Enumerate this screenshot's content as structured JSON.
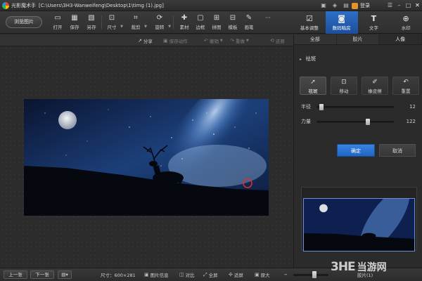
{
  "app": {
    "name": "光影魔术手",
    "path": "[C:\\Users\\3H3-Wanweifeng\\Desktop\\1\\timg (1).jpg]",
    "login_label": "登录"
  },
  "toolbar": {
    "browse_label": "浏览图片",
    "tools": [
      {
        "label": "打开",
        "icon": "folder-open-icon"
      },
      {
        "label": "保存",
        "icon": "save-icon"
      },
      {
        "label": "另存",
        "icon": "save-as-icon"
      },
      {
        "label": "尺寸",
        "icon": "resize-icon"
      },
      {
        "label": "裁剪",
        "icon": "crop-icon"
      },
      {
        "label": "旋转",
        "icon": "rotate-icon"
      },
      {
        "label": "素材",
        "icon": "material-icon"
      },
      {
        "label": "边框",
        "icon": "border-icon"
      },
      {
        "label": "拼图",
        "icon": "collage-icon"
      },
      {
        "label": "模板",
        "icon": "template-icon"
      },
      {
        "label": "画笔",
        "icon": "brush-icon"
      }
    ],
    "right_tabs": [
      {
        "label": "基本调整",
        "icon": "adjust-icon"
      },
      {
        "label": "数码暗房",
        "icon": "camera-icon"
      },
      {
        "label": "文字",
        "icon": "text-icon"
      },
      {
        "label": "水印",
        "icon": "watermark-icon"
      }
    ]
  },
  "actions": {
    "share": "分享",
    "save_action": "保存动作",
    "undo": "撤销",
    "redo": "重做",
    "restore": "还原"
  },
  "panel": {
    "subtabs": [
      "全部",
      "胶片",
      "人像"
    ],
    "section_title": "祛斑",
    "modes": [
      {
        "label": "祛斑",
        "icon": "cursor-icon"
      },
      {
        "label": "移动",
        "icon": "move-icon"
      },
      {
        "label": "橡皮擦",
        "icon": "eraser-icon"
      },
      {
        "label": "重置",
        "icon": "reset-icon"
      }
    ],
    "radius_label": "半径",
    "radius_value": "12",
    "strength_label": "力量",
    "strength_value": "122",
    "confirm_label": "确定",
    "cancel_label": "取消"
  },
  "statusbar": {
    "prev": "上一张",
    "next": "下一张",
    "menu_icon": "menu-icon",
    "size": "尺寸：600×281",
    "image_info": "图片信息",
    "compare": "对比",
    "fullscreen": "全屏",
    "fit": "适屏",
    "original": "原大",
    "filmstrip": "胶片(1)"
  },
  "watermark": {
    "logo": "3HE",
    "site": "当游网"
  }
}
